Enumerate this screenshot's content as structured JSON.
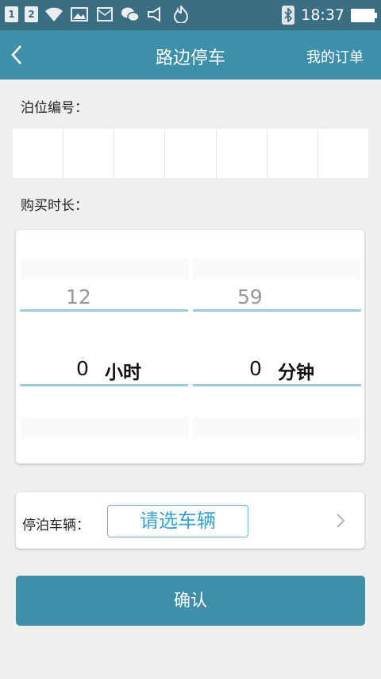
{
  "status_bar": {
    "sim1": "1",
    "sim2": "2",
    "time": "18:37",
    "icons": [
      "wifi-icon",
      "gallery-icon",
      "mail-icon",
      "wechat-icon",
      "volume-icon",
      "fire-icon",
      "bluetooth-icon",
      "battery-icon"
    ]
  },
  "header": {
    "title": "路边停车",
    "orders_label": "我的订单"
  },
  "berth": {
    "label": "泊位编号：",
    "cells": [
      "",
      "",
      "",
      "",
      "",
      "",
      ""
    ]
  },
  "duration": {
    "label": "购买时长：",
    "hours": {
      "prev": "12",
      "value": "0",
      "unit": "小时"
    },
    "minutes": {
      "prev": "59",
      "value": "0",
      "unit": "分钟"
    }
  },
  "vehicle": {
    "label": "停泊车辆：",
    "select_label": "请选车辆"
  },
  "confirm_label": "确认",
  "colors": {
    "status_bar": "#3c6e83",
    "primary": "#3f8fa9",
    "picker_line": "#9ccbdc",
    "link": "#3aa3d3"
  }
}
